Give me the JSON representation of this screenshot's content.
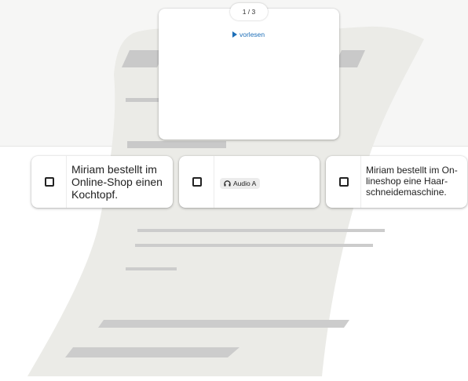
{
  "question": {
    "counter": "1 / 3",
    "read_aloud_label": "vorlesen",
    "read_aloud_icon": "play-icon"
  },
  "options": [
    {
      "text": "Miriam bestellt im Online-Shop einen Kochtopf."
    },
    {
      "audio_label": "Audio A",
      "audio_icon": "headphones-icon"
    },
    {
      "text": "Miriam bestellt im On-lineshop eine Haar-schneidemaschine."
    }
  ],
  "colors": {
    "accent": "#1e6fb8",
    "paper": "#ebebe7",
    "paper_lines": "#cacaca",
    "background": "#f6f6f5"
  }
}
